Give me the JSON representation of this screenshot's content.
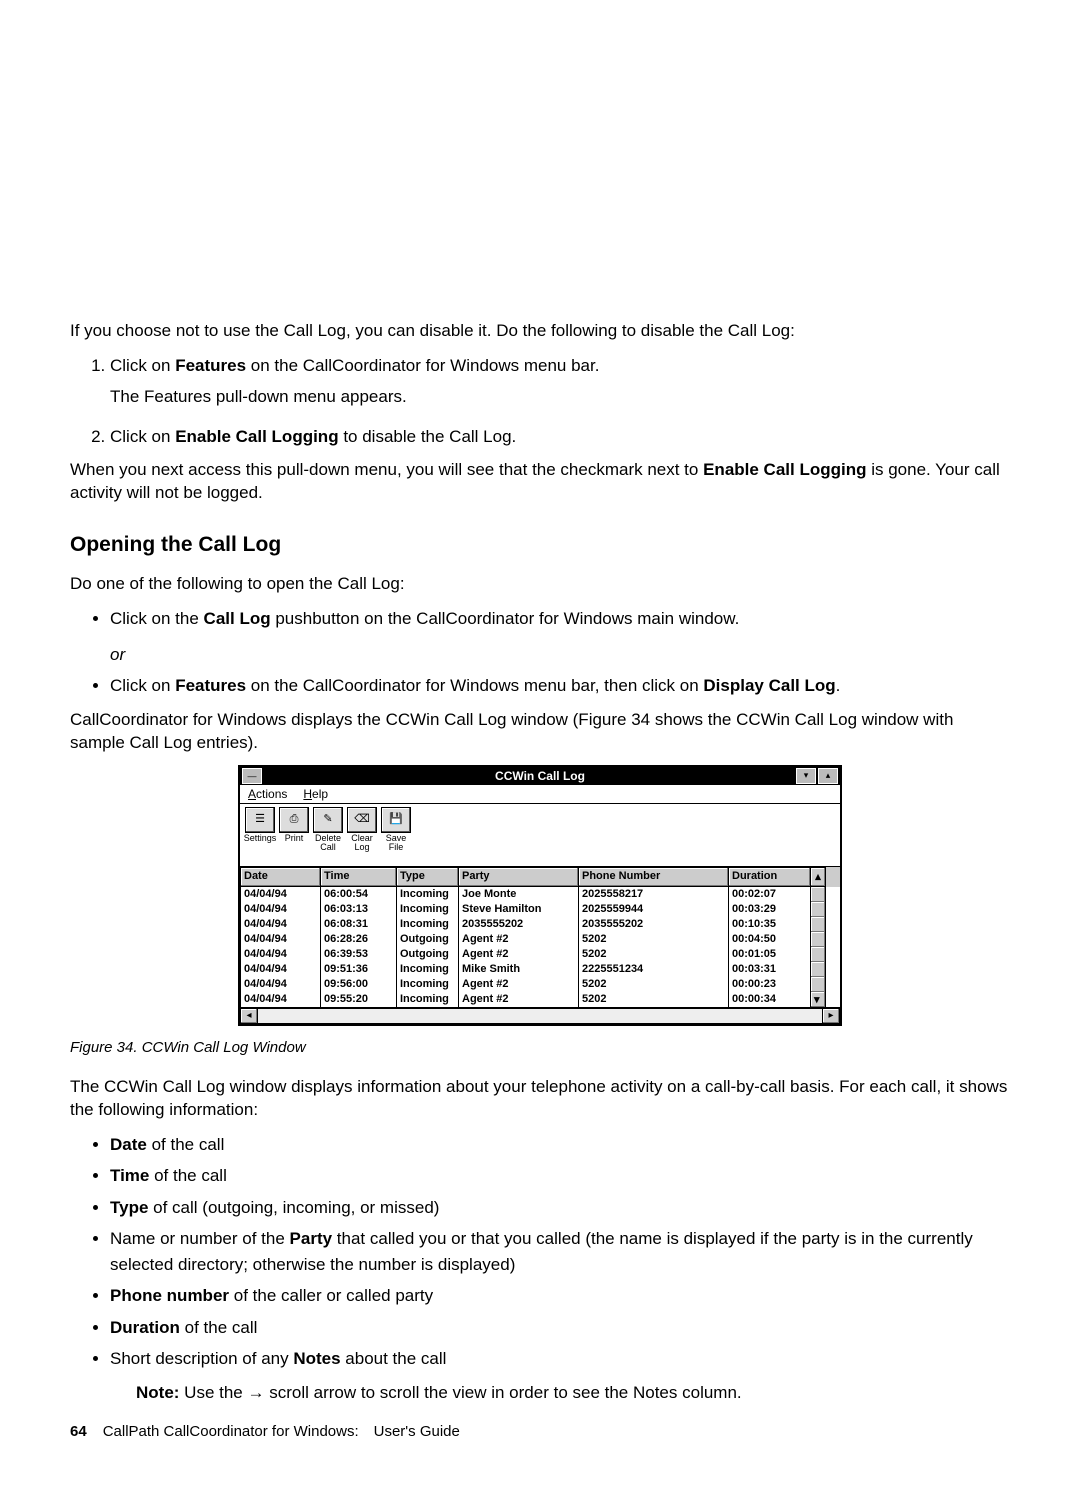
{
  "intro": "If you choose not to use the Call Log, you can disable it.  Do the following to disable the Call Log:",
  "steps": [
    {
      "pre": "Click on ",
      "bold": "Features",
      "post": " on the CallCoordinator for Windows menu bar.",
      "sub": "The Features pull-down menu appears."
    },
    {
      "pre": "Click on ",
      "bold": "Enable Call Logging",
      "post": " to disable the Call Log."
    }
  ],
  "after_steps_1": "When you next access this pull-down menu, you will see that the checkmark next to ",
  "after_steps_bold": "Enable Call Logging",
  "after_steps_2": " is gone.  Your call activity will not be logged.",
  "section_heading": "Opening the Call Log",
  "open_intro": "Do one of the following to open the Call Log:",
  "open_b1_pre": "Click on the ",
  "open_b1_bold": "Call Log",
  "open_b1_post": " pushbutton on the CallCoordinator for Windows main window.",
  "open_or": "or",
  "open_b2_pre": "Click on ",
  "open_b2_bold1": "Features",
  "open_b2_mid": " on the CallCoordinator for Windows menu bar, then click on ",
  "open_b2_bold2": "Display Call Log",
  "open_b2_post": ".",
  "displays_p": "CallCoordinator for Windows displays the CCWin Call Log window (Figure 34 shows the CCWin Call Log window with sample Call Log entries).",
  "figure": {
    "title": "CCWin Call Log",
    "menu": {
      "actions": "Actions",
      "help": "Help"
    },
    "toolbar": [
      {
        "label": "Settings"
      },
      {
        "label": "Print"
      },
      {
        "label": "Delete\nCall"
      },
      {
        "label": "Clear\nLog"
      },
      {
        "label": "Save File"
      }
    ],
    "headers": [
      "Date",
      "Time",
      "Type",
      "Party",
      "Phone Number",
      "Duration"
    ],
    "rows": [
      [
        "04/04/94",
        "06:00:54",
        "Incoming",
        "Joe Monte",
        "2025558217",
        "00:02:07"
      ],
      [
        "04/04/94",
        "06:03:13",
        "Incoming",
        "Steve Hamilton",
        "2025559944",
        "00:03:29"
      ],
      [
        "04/04/94",
        "06:08:31",
        "Incoming",
        "2035555202",
        "2035555202",
        "00:10:35"
      ],
      [
        "04/04/94",
        "06:28:26",
        "Outgoing",
        "Agent #2",
        "5202",
        "00:04:50"
      ],
      [
        "04/04/94",
        "06:39:53",
        "Outgoing",
        "Agent #2",
        "5202",
        "00:01:05"
      ],
      [
        "04/04/94",
        "09:51:36",
        "Incoming",
        "Mike Smith",
        "2225551234",
        "00:03:31"
      ],
      [
        "04/04/94",
        "09:56:00",
        "Incoming",
        "Agent #2",
        "5202",
        "00:00:23"
      ],
      [
        "04/04/94",
        "09:55:20",
        "Incoming",
        "Agent #2",
        "5202",
        "00:00:34"
      ]
    ],
    "caption": "Figure 34. CCWin Call Log Window"
  },
  "desc_p": "The CCWin Call Log window displays information about your telephone activity on a call-by-call basis. For each call, it shows the following information:",
  "info_list": {
    "b1_bold": "Date",
    "b1_post": " of the call",
    "b2_bold": "Time",
    "b2_post": " of the call",
    "b3_bold": "Type",
    "b3_post": " of call (outgoing, incoming, or missed)",
    "b4_pre": "Name or number of the ",
    "b4_bold": "Party",
    "b4_post": " that called you or that you called (the name is displayed if the party is in the currently selected directory; otherwise the number is displayed)",
    "b5_bold": "Phone number",
    "b5_post": " of the caller or called party",
    "b6_bold": "Duration",
    "b6_post": " of the call",
    "b7_pre": "Short description of any ",
    "b7_bold": "Notes",
    "b7_post": " about the call"
  },
  "note": {
    "label": "Note:",
    "text_pre": "  Use the ",
    "arrow": "→",
    "text_post": " scroll arrow to scroll the view in order to see the Notes column."
  },
  "footer": {
    "page": "64",
    "text": "CallPath CallCoordinator for Windows: User's Guide"
  }
}
